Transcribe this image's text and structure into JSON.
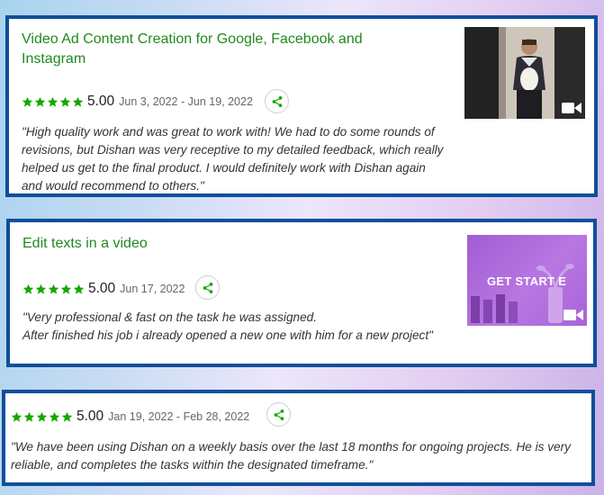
{
  "colors": {
    "accent_green": "#1f8a1f",
    "card_border": "#0e4f9a",
    "star_green": "#14a800"
  },
  "reviews": [
    {
      "title": "Video Ad Content Creation for Google, Facebook and Instagram",
      "title_lines": [
        "Video Ad Content Creation for Google, Facebook and",
        "Instagram"
      ],
      "rating": "5.00",
      "stars": 5,
      "dates": "Jun 3, 2022 - Jun 19, 2022",
      "text": "\"High quality work and was great to work with! We had to do some rounds of revisions, but Dishan was very receptive to my detailed feedback, which really helped us get to the final product. I would definitely work with Dishan again and would recommend to others.\"",
      "thumbnail": {
        "type": "video",
        "icon": "video-camera-icon"
      }
    },
    {
      "title": "Edit texts in a video",
      "rating": "5.00",
      "stars": 5,
      "dates": "Jun 17, 2022",
      "text": "\"Very professional & fast on the task he was assigned.\nAfter finished his job i already opened a new one with him for a new project\"",
      "thumbnail": {
        "type": "video",
        "overlay_text": "GET START E",
        "icon": "video-camera-icon"
      }
    },
    {
      "rating": "5.00",
      "stars": 5,
      "dates": "Jan 19, 2022 - Feb 28, 2022",
      "text": "\"We have been using Dishan on a weekly basis over the last 18 months for ongoing projects. He is very reliable, and completes the tasks within the designated timeframe.\""
    }
  ]
}
